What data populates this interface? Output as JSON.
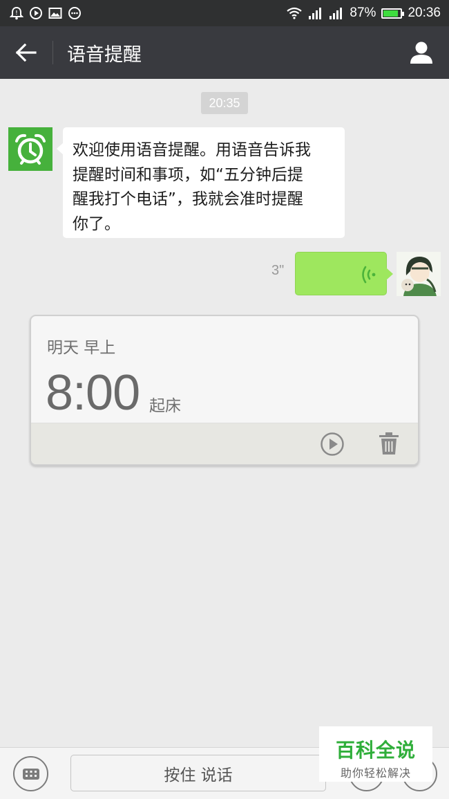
{
  "status_bar": {
    "icons_left": [
      "alarm-icon",
      "play-icon",
      "image-icon",
      "more-dots-icon"
    ],
    "battery_percent": "87%",
    "battery_level": 0.87,
    "time": "20:36"
  },
  "header": {
    "title": "语音提醒",
    "back_icon": "arrow-left-icon",
    "profile_icon": "person-icon"
  },
  "chat": {
    "timestamp": "20:35",
    "bot_message": {
      "lines": [
        "欢迎使用语音提醒。用语音告诉我",
        "提醒时间和事项，如“五分钟后提",
        "醒我打个电话”，我就会准时提醒",
        "你了。"
      ]
    },
    "voice_message": {
      "duration": "3\""
    }
  },
  "reminder": {
    "day": "明天 早上",
    "time": "8:00",
    "label": "起床"
  },
  "input_bar": {
    "hold_to_talk": "按住 说话"
  },
  "watermark": {
    "title": "百科全说",
    "subtitle": "助你轻松解决"
  },
  "colors": {
    "header_bg": "#393a3f",
    "status_bg": "#2f3031",
    "chat_bg": "#ebebeb",
    "voice_bubble": "#9ee75e",
    "bot_avatar": "#46b13c",
    "watermark_green": "#2fae3a"
  }
}
